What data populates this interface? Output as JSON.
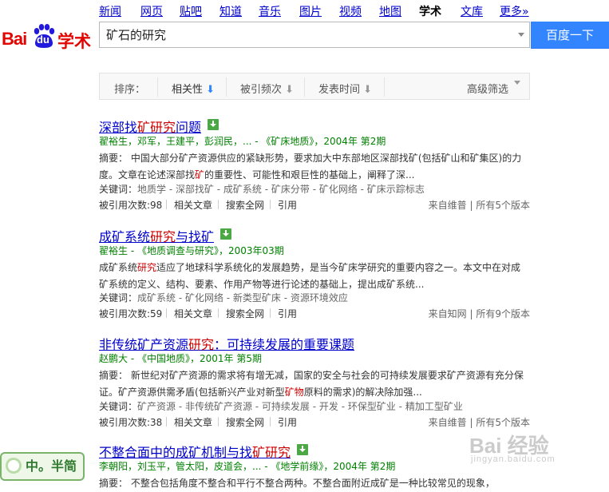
{
  "nav": {
    "items": [
      {
        "label": "新闻"
      },
      {
        "label": "网页"
      },
      {
        "label": "贴吧"
      },
      {
        "label": "知道"
      },
      {
        "label": "音乐"
      },
      {
        "label": "图片"
      },
      {
        "label": "视频"
      },
      {
        "label": "地图"
      },
      {
        "label": "学术",
        "active": true
      },
      {
        "label": "文库"
      },
      {
        "label": "更多»"
      }
    ]
  },
  "logo": {
    "bai": "Bai",
    "du": "du",
    "xueshu": "学术"
  },
  "search": {
    "query": "矿石的研究",
    "button": "百度一下"
  },
  "filters": {
    "sort_label": "排序：",
    "relevance": "相关性",
    "citations": "被引频次",
    "pub_time": "发表时间",
    "advanced": "高级筛选",
    "arrow": "⬇"
  },
  "results": [
    {
      "title_parts": [
        "深部找",
        "矿研究",
        "问题"
      ],
      "meta": "翟裕生，邓军，王建平，彭润民，... - 《矿床地质》，2004年 第2期",
      "abstract_label": "摘要：",
      "abstract_parts": [
        "中国大部分矿产资源供应的紧缺形势，要求加大中东部地区深部找矿(包括矿山和矿集区)的力度。文章在论述深部找",
        "矿",
        "的重要性、可能性和艰巨性的基础上，阐释了深..."
      ],
      "keywords_label": "关键词：",
      "keywords": "地质学 - 深部找矿 - 成矿系统 - 矿床分带 - 矿化网络 - 矿床示踪标志",
      "cited": "被引用次数:98",
      "related": "相关文章",
      "search_all": "搜索全网",
      "cite": "引用",
      "source": "来自维普",
      "versions": "所有5个版本"
    },
    {
      "title_parts": [
        "成矿系统",
        "研究",
        "与找矿"
      ],
      "meta": "翟裕生 - 《地质调查与研究》，2003年03期",
      "abstract_label": "",
      "abstract_parts": [
        "成矿系统",
        "研究",
        "适应了地球科学系统化的发展趋势，是当今矿床学研究的重要内容之一。本文中在对成矿系统的定义、结构、要素、作用产物等进行论述的基础上，提出成矿系统..."
      ],
      "keywords_label": "关键词：",
      "keywords": "成矿系统 - 矿化网络 - 新类型矿床 - 资源环境效应",
      "cited": "被引用次数:59",
      "related": "相关文章",
      "search_all": "搜索全网",
      "cite": "引用",
      "source": "来自知网",
      "versions": "所有9个版本"
    },
    {
      "title_parts": [
        "非传统矿产资源",
        "研究",
        "：可持续发展的重要课题"
      ],
      "meta": "赵鹏大 - 《中国地质》，2001年 第5期",
      "abstract_label": "摘要：",
      "abstract_parts": [
        "新世纪对矿产资源的需求将有增无减，国家的安全与社会的可持续发展要求矿产资源有充分保证。矿产资源供需矛盾(包括新兴产业对新型",
        "矿物",
        "原料的需求)的解决除加强..."
      ],
      "keywords_label": "关键词：",
      "keywords": "矿产资源 - 非传统矿产资源 - 可持续发展 - 开发 - 环保型矿业 - 精加工型矿业",
      "cited": "被引用次数:38",
      "related": "相关文章",
      "search_all": "搜索全网",
      "cite": "引用",
      "source": "来自维普",
      "versions": "所有5个版本"
    },
    {
      "title_parts": [
        "不整合面中的成矿机制与找",
        "矿研究",
        ""
      ],
      "meta": "李朝阳，刘玉平，管太阳，皮道会，... - 《地学前缘》，2004年 第2期",
      "abstract_label": "摘要：",
      "abstract_parts": [
        "不整合包括角度不整合和平行不整合两种。不整合面附近成矿是一种比较常见的现象，",
        "",
        ""
      ]
    }
  ],
  "watermark": {
    "left": "中。半简",
    "right_brand": "Bai 经验",
    "right_sub": "jingyan.baidu.com"
  }
}
